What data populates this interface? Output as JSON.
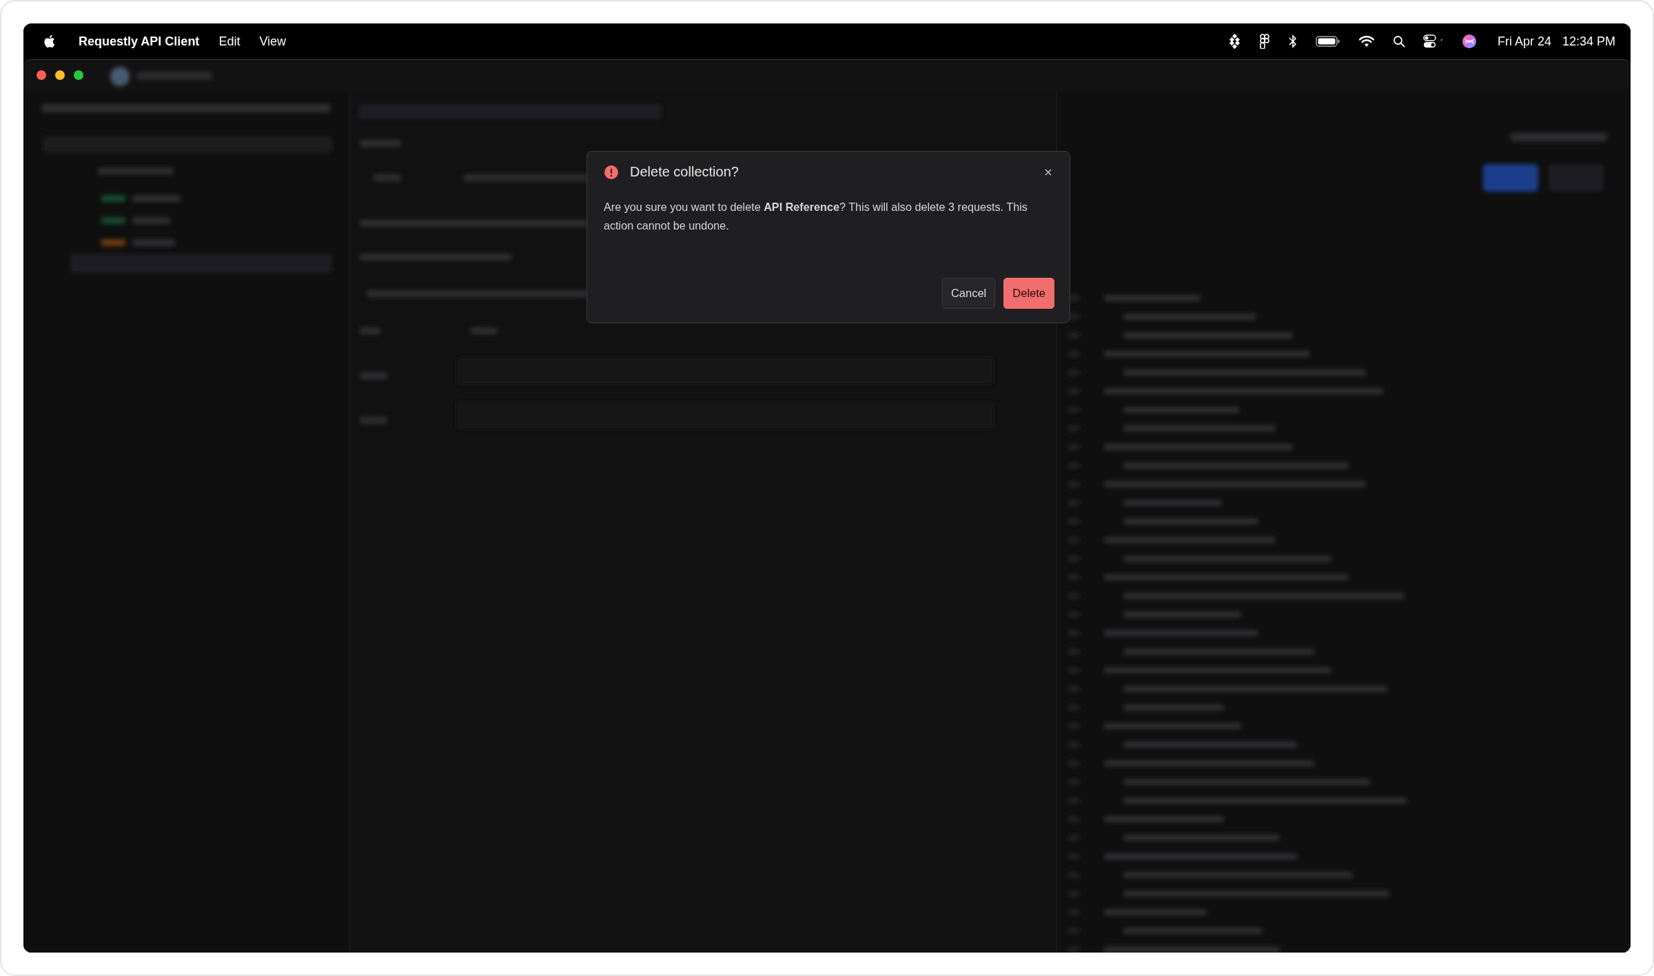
{
  "menu_bar": {
    "app_name": "Requestly API Client",
    "menus": [
      "Edit",
      "View"
    ],
    "date": "Fri Apr 24",
    "time": "12:34 PM"
  },
  "dialog": {
    "title": "Delete collection?",
    "message": "Are you sure you want to delete **API Reference**? This will also delete 3 requests. This action cannot be undone.",
    "buttons": [
      {
        "label": "Cancel",
        "kind": "secondary"
      },
      {
        "label": "Delete",
        "kind": "danger"
      }
    ]
  }
}
